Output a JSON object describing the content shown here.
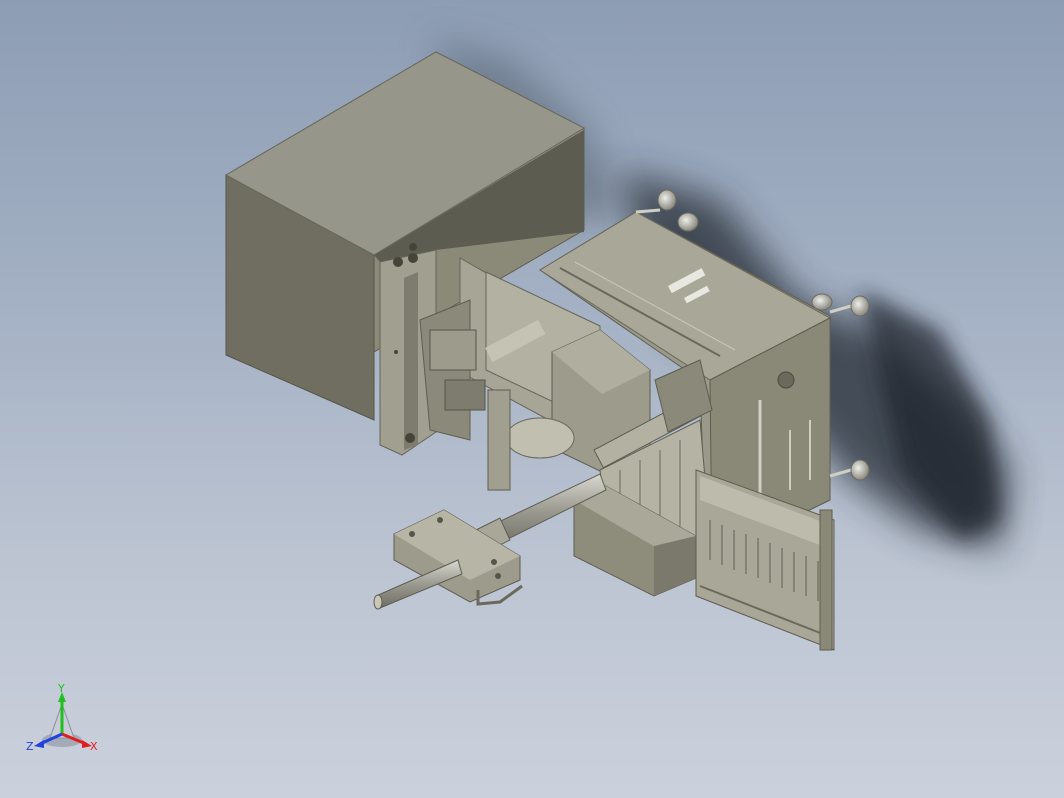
{
  "viewport": {
    "background_top": "#8d9db4",
    "background_bottom": "#cbd1dc"
  },
  "model": {
    "body_color": "#8e8d7c",
    "shadow_color": "#2b313a"
  },
  "triad": {
    "x_label": "X",
    "y_label": "Y",
    "z_label": "Z",
    "x_color": "#e02020",
    "y_color": "#20c020",
    "z_color": "#2040e0"
  }
}
